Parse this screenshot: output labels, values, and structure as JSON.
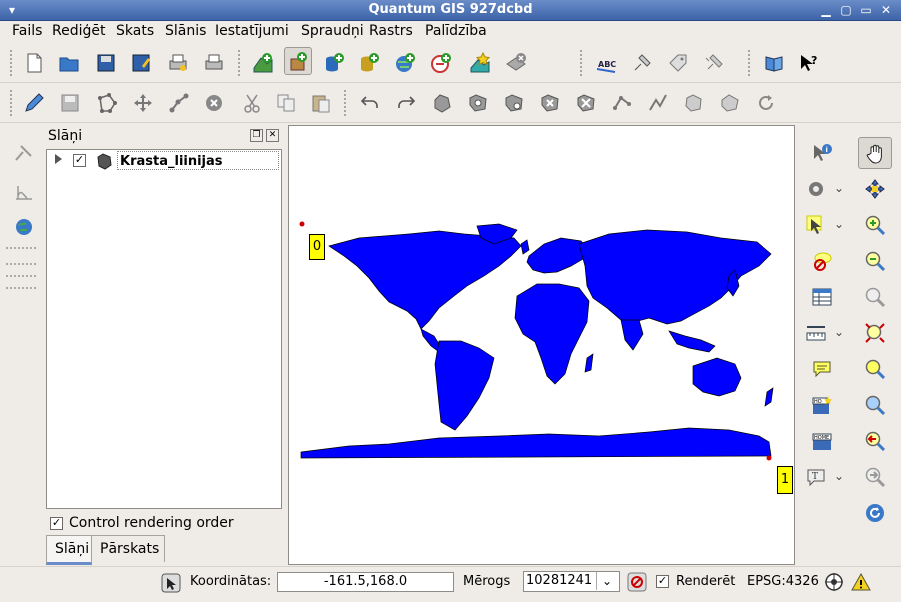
{
  "window": {
    "title": "Quantum GIS 927dcbd"
  },
  "menu": [
    {
      "label": "Fails"
    },
    {
      "label": "Rediģēt"
    },
    {
      "label": "Skats"
    },
    {
      "label": "Slānis"
    },
    {
      "label": "Iestatījumi"
    },
    {
      "label": "Spraudņi"
    },
    {
      "label": "Rastrs"
    },
    {
      "label": "Palīdzība"
    }
  ],
  "layers_panel": {
    "title": "Slāņi",
    "layers": [
      {
        "name": "Krasta_liinijas",
        "checked": true
      }
    ],
    "control_rendering_order_label": "Control rendering order",
    "control_rendering_order_checked": true,
    "tabs": [
      {
        "label": "Slāņi",
        "active": true
      },
      {
        "label": "Pārskats",
        "active": false
      }
    ]
  },
  "map": {
    "land_color": "#0000ff",
    "label_color": "#ffff00",
    "labels": [
      "0",
      "1"
    ]
  },
  "status": {
    "coordinates_label": "Koordinātas:",
    "coordinates_value": "-161.5,168.0",
    "scale_label": "Mērogs",
    "scale_value": "10281241",
    "render_label": "Renderēt",
    "render_checked": true,
    "crs": "EPSG:4326"
  }
}
